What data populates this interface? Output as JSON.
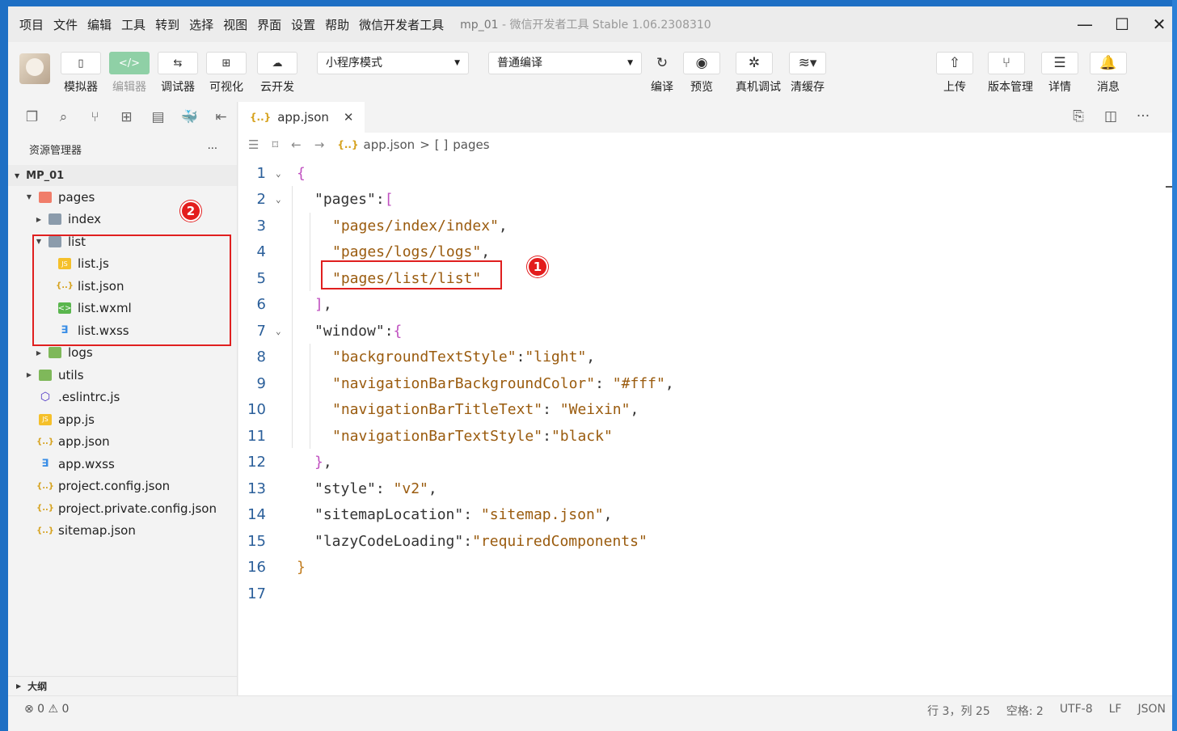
{
  "menu": [
    "项目",
    "文件",
    "编辑",
    "工具",
    "转到",
    "选择",
    "视图",
    "界面",
    "设置",
    "帮助",
    "微信开发者工具"
  ],
  "window_title": {
    "project": "mp_01",
    "separator": "-",
    "app": "微信开发者工具 Stable 1.06.2308310"
  },
  "toolbar": {
    "left_buttons": [
      {
        "label": "模拟器",
        "icon": "phone-icon",
        "glyph": "▯"
      },
      {
        "label": "编辑器",
        "icon": "code-icon",
        "glyph": "</>"
      },
      {
        "label": "调试器",
        "icon": "debug-icon",
        "glyph": "⇆"
      },
      {
        "label": "可视化",
        "icon": "layout-icon",
        "glyph": "⊞"
      },
      {
        "label": "云开发",
        "icon": "cloud-icon",
        "glyph": "☁"
      }
    ],
    "mode_select": "小程序模式",
    "compile_select": "普通编译",
    "right_buttons": [
      {
        "label": "编译",
        "glyph": "↻"
      },
      {
        "label": "预览",
        "glyph": "◉"
      },
      {
        "label": "真机调试",
        "glyph": "✲"
      },
      {
        "label": "清缓存",
        "glyph": "≋▾"
      }
    ],
    "far_right": [
      {
        "label": "上传",
        "glyph": "⇧"
      },
      {
        "label": "版本管理",
        "glyph": "⑂"
      },
      {
        "label": "详情",
        "glyph": "☰"
      },
      {
        "label": "消息",
        "glyph": "🔔"
      }
    ]
  },
  "explorer": {
    "title": "资源管理器",
    "more": "···",
    "project": "MP_01",
    "tree": [
      {
        "label": "pages",
        "indent": 1,
        "arrow": "▼",
        "icon": "fold-red"
      },
      {
        "label": "index",
        "indent": 2,
        "arrow": "▶",
        "icon": "fold"
      },
      {
        "label": "list",
        "indent": 2,
        "arrow": "▼",
        "icon": "fold"
      },
      {
        "label": "list.js",
        "indent": 3,
        "arrow": "",
        "icon": "js",
        "glyph": "JS"
      },
      {
        "label": "list.json",
        "indent": 3,
        "arrow": "",
        "icon": "json",
        "glyph": "{..}"
      },
      {
        "label": "list.wxml",
        "indent": 3,
        "arrow": "",
        "icon": "wxml",
        "glyph": "<>"
      },
      {
        "label": "list.wxss",
        "indent": 3,
        "arrow": "",
        "icon": "css",
        "glyph": "∃"
      },
      {
        "label": "logs",
        "indent": 2,
        "arrow": "▶",
        "icon": "fold-green"
      },
      {
        "label": "utils",
        "indent": 1,
        "arrow": "▶",
        "icon": "fold-green"
      },
      {
        "label": ".eslintrc.js",
        "indent": 1,
        "arrow": "",
        "icon": "eslint",
        "glyph": "⬡"
      },
      {
        "label": "app.js",
        "indent": 1,
        "arrow": "",
        "icon": "js",
        "glyph": "JS"
      },
      {
        "label": "app.json",
        "indent": 1,
        "arrow": "",
        "icon": "json",
        "glyph": "{..}"
      },
      {
        "label": "app.wxss",
        "indent": 1,
        "arrow": "",
        "icon": "css",
        "glyph": "∃"
      },
      {
        "label": "project.config.json",
        "indent": 1,
        "arrow": "",
        "icon": "json",
        "glyph": "{..}"
      },
      {
        "label": "project.private.config.json",
        "indent": 1,
        "arrow": "",
        "icon": "json",
        "glyph": "{..}"
      },
      {
        "label": "sitemap.json",
        "indent": 1,
        "arrow": "",
        "icon": "json",
        "glyph": "{..}"
      }
    ],
    "outline": "大纲"
  },
  "editor": {
    "tab": {
      "label": "app.json",
      "icon": "{..}",
      "close": "✕"
    },
    "breadcrumb": {
      "file": "app.json",
      "sep": ">",
      "node_icon": "[ ]",
      "node": "pages"
    },
    "lines": [
      {
        "n": "1",
        "fold": "⌄",
        "indent": 0,
        "parts": [
          [
            "b",
            "{"
          ]
        ]
      },
      {
        "n": "2",
        "fold": "⌄",
        "indent": 1,
        "parts": [
          [
            "k",
            "\"pages\""
          ],
          [
            "k",
            ":"
          ],
          [
            "b",
            "["
          ]
        ]
      },
      {
        "n": "3",
        "fold": "",
        "indent": 2,
        "parts": [
          [
            "s",
            "\"pages/index/index\""
          ],
          [
            "k",
            ","
          ]
        ]
      },
      {
        "n": "4",
        "fold": "",
        "indent": 2,
        "parts": [
          [
            "s",
            "\"pages/logs/logs\""
          ],
          [
            "k",
            ","
          ]
        ]
      },
      {
        "n": "5",
        "fold": "",
        "indent": 2,
        "parts": [
          [
            "s",
            "\"pages/list/list\""
          ]
        ]
      },
      {
        "n": "6",
        "fold": "",
        "indent": 1,
        "parts": [
          [
            "b",
            "]"
          ],
          [
            "k",
            ","
          ]
        ]
      },
      {
        "n": "7",
        "fold": "⌄",
        "indent": 1,
        "parts": [
          [
            "k",
            "\"window\""
          ],
          [
            "k",
            ":"
          ],
          [
            "b",
            "{"
          ]
        ]
      },
      {
        "n": "8",
        "fold": "",
        "indent": 2,
        "parts": [
          [
            "s",
            "\"backgroundTextStyle\""
          ],
          [
            "k",
            ":"
          ],
          [
            "s",
            "\"light\""
          ],
          [
            "k",
            ","
          ]
        ]
      },
      {
        "n": "9",
        "fold": "",
        "indent": 2,
        "parts": [
          [
            "s",
            "\"navigationBarBackgroundColor\""
          ],
          [
            "k",
            ": "
          ],
          [
            "s",
            "\"#fff\""
          ],
          [
            "k",
            ","
          ]
        ]
      },
      {
        "n": "10",
        "fold": "",
        "indent": 2,
        "parts": [
          [
            "s",
            "\"navigationBarTitleText\""
          ],
          [
            "k",
            ": "
          ],
          [
            "s",
            "\"Weixin\""
          ],
          [
            "k",
            ","
          ]
        ]
      },
      {
        "n": "11",
        "fold": "",
        "indent": 2,
        "parts": [
          [
            "s",
            "\"navigationBarTextStyle\""
          ],
          [
            "k",
            ":"
          ],
          [
            "s",
            "\"black\""
          ]
        ]
      },
      {
        "n": "12",
        "fold": "",
        "indent": 1,
        "parts": [
          [
            "b",
            "}"
          ],
          [
            "k",
            ","
          ]
        ]
      },
      {
        "n": "13",
        "fold": "",
        "indent": 1,
        "parts": [
          [
            "k",
            "\"style\""
          ],
          [
            "k",
            ": "
          ],
          [
            "s",
            "\"v2\""
          ],
          [
            "k",
            ","
          ]
        ]
      },
      {
        "n": "14",
        "fold": "",
        "indent": 1,
        "parts": [
          [
            "k",
            "\"sitemapLocation\""
          ],
          [
            "k",
            ": "
          ],
          [
            "s",
            "\"sitemap.json\""
          ],
          [
            "k",
            ","
          ]
        ]
      },
      {
        "n": "15",
        "fold": "",
        "indent": 1,
        "parts": [
          [
            "k",
            "\"lazyCodeLoading\""
          ],
          [
            "k",
            ":"
          ],
          [
            "s",
            "\"requiredComponents\""
          ]
        ]
      },
      {
        "n": "16",
        "fold": "",
        "indent": 0,
        "parts": [
          [
            "p",
            "}"
          ]
        ]
      },
      {
        "n": "17",
        "fold": "",
        "indent": 0,
        "parts": []
      }
    ]
  },
  "annotations": {
    "badge1": "1",
    "badge2": "2"
  },
  "status": {
    "problems": "⊗ 0 ⚠ 0",
    "position": "行 3，列 25",
    "spaces": "空格: 2",
    "encoding": "UTF-8",
    "eol": "LF",
    "language": "JSON"
  },
  "colors": {
    "highlight": "#e01f1f",
    "badge": "#e31d1d",
    "desktop": "#1e6fc4"
  }
}
